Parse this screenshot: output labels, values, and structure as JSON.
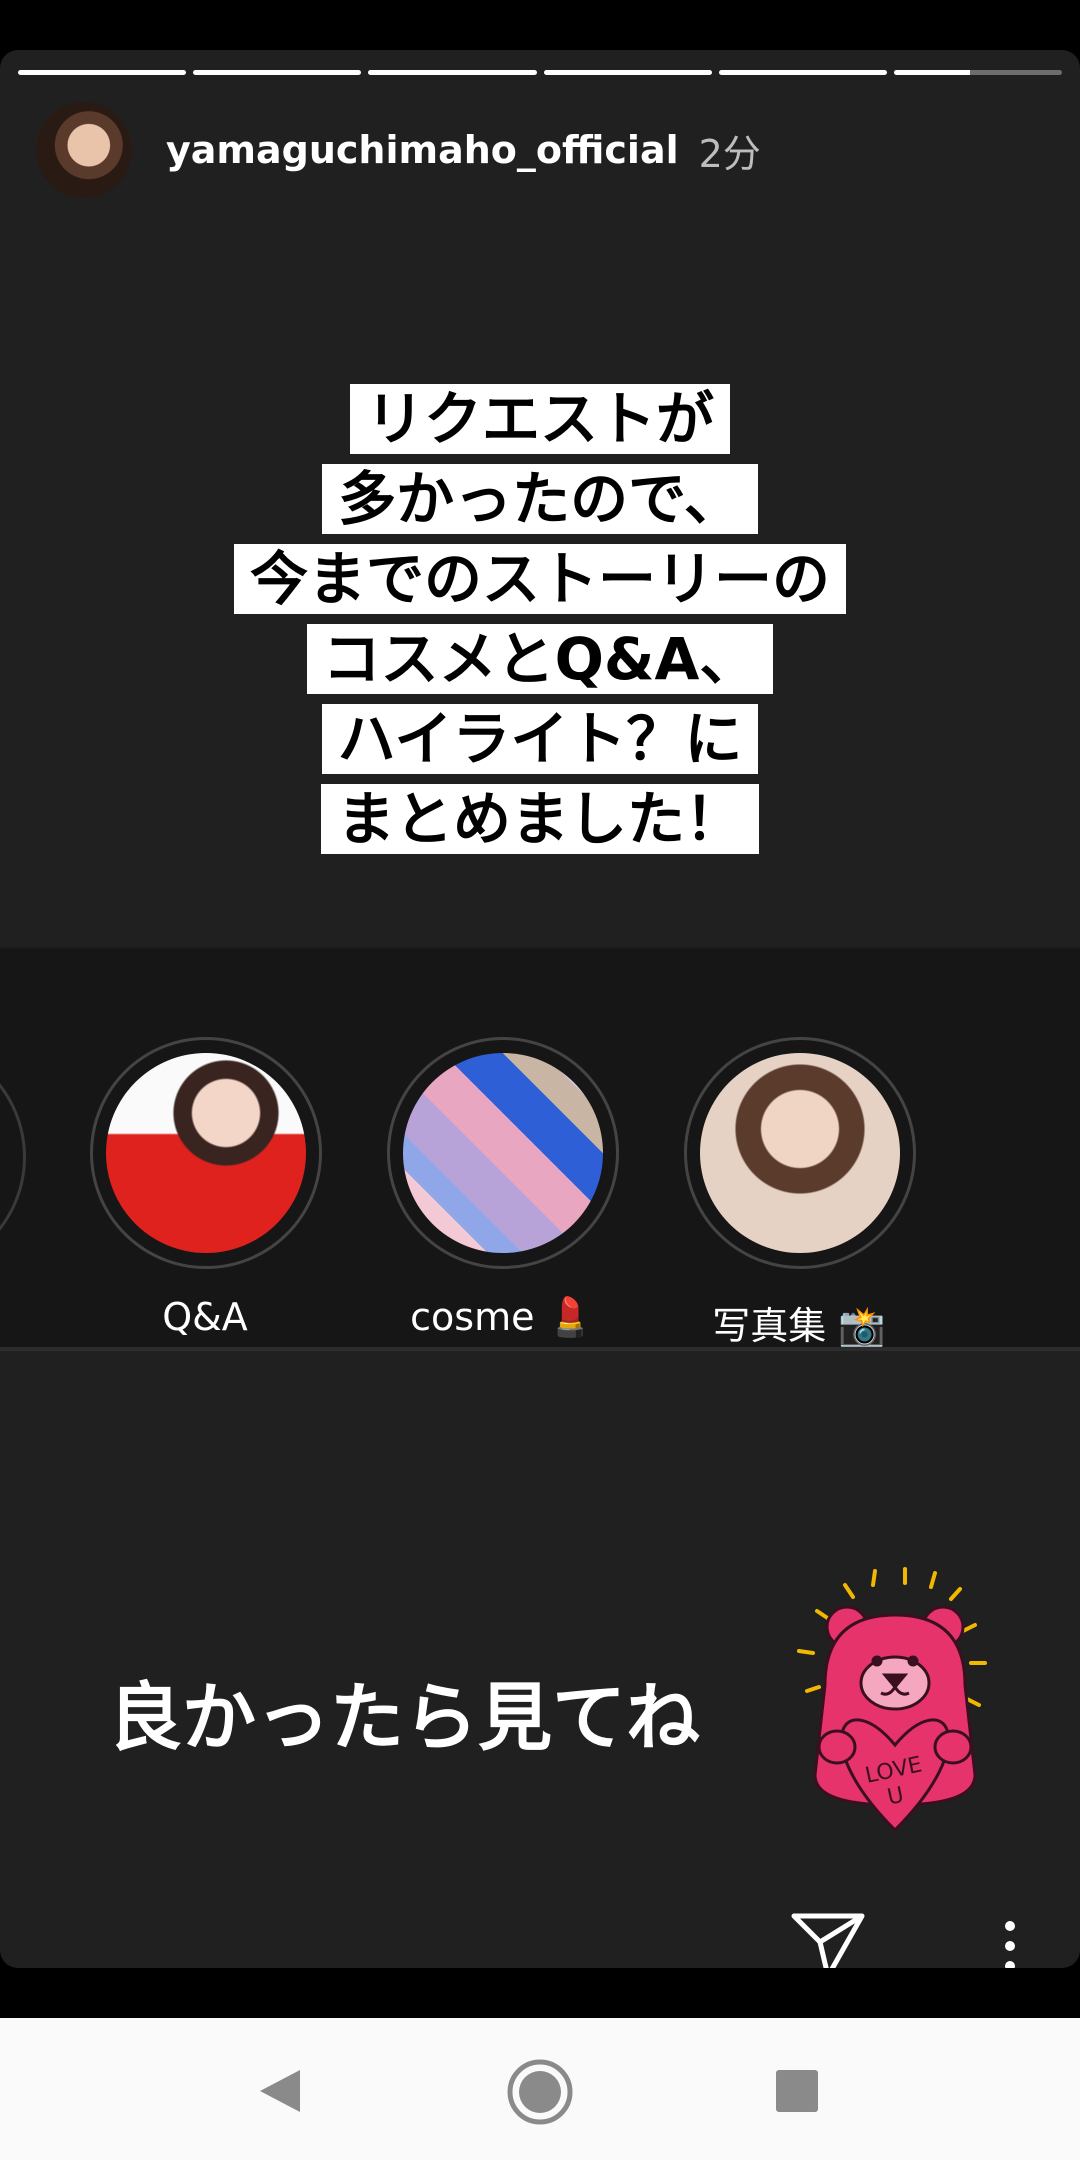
{
  "story": {
    "segments": [
      {
        "fill": 1.0
      },
      {
        "fill": 1.0
      },
      {
        "fill": 1.0
      },
      {
        "fill": 1.0
      },
      {
        "fill": 1.0
      },
      {
        "fill": 0.45
      }
    ],
    "username": "yamaguchimaho_official",
    "time": "2分",
    "text_lines": [
      "リクエストが",
      "多かったので、",
      "今までのストーリーの",
      "コスメとQ&A、",
      "ハイライト？に",
      "まとめました！"
    ],
    "highlights": [
      {
        "label": "Q&A"
      },
      {
        "label": "cosme 💄"
      },
      {
        "label": "写真集 📸"
      }
    ],
    "caption": "良かったら見てね",
    "sticker": {
      "icon": "bear-love-u-sticker",
      "line1": "LOVE",
      "line2": "U"
    },
    "colors": {
      "background": "#202020",
      "sticker_pink": "#e6336c"
    }
  },
  "nav": {
    "back": "back-icon",
    "home": "home-icon",
    "recents": "recents-icon"
  }
}
